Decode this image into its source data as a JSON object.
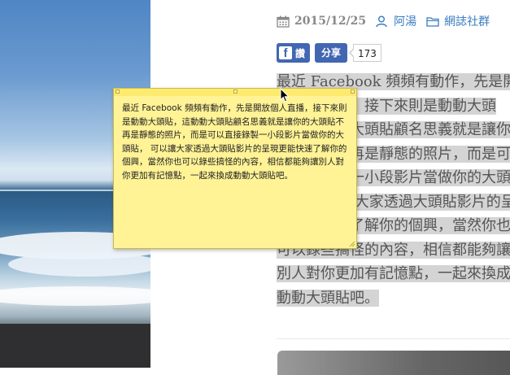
{
  "meta": {
    "date": "2015/12/25",
    "author": "阿湯",
    "category": "網誌社群",
    "icons": [
      "calendar-icon",
      "user-icon",
      "folder-icon"
    ]
  },
  "social": {
    "like_label": "讚",
    "share_label": "分享",
    "count": "173"
  },
  "article": {
    "text": "最近 Facebook 頻頻有動作，先是開放個人直播，接下來則是動動大頭貼，這動動大頭貼顧名思義就是讓你的大頭貼不再是靜態的照片，而是可以直接錄製一小段影片當做你的大頭貼， 可以讓大家透過大頭貼影片的呈現更能快速了解你的個興，當然你也可以錄些搞怪的內容，相信都能夠讓別人對你更加有記憶點，一起來換成動動大頭貼吧。"
  },
  "note": {
    "text": "最近 Facebook 頻頻有動作，先是開放個人直播，接下來則是動動大頭貼，這動動大頭貼顧名思義就是讓你的大頭貼不再是靜態的照片，而是可以直接錄製一小段影片當做你的大頭貼， 可以讓大家透過大頭貼影片的呈現更能快速了解你的個興，當然你也可以錄些搞怪的內容，相信都能夠讓別人對你更加有記憶點，一起來換成動動大頭貼吧。"
  },
  "colors": {
    "facebook_blue": "#4267b2",
    "link_blue": "#3a7bbf",
    "note_yellow": "#fff396",
    "highlight_gray": "#d4d4d4"
  }
}
